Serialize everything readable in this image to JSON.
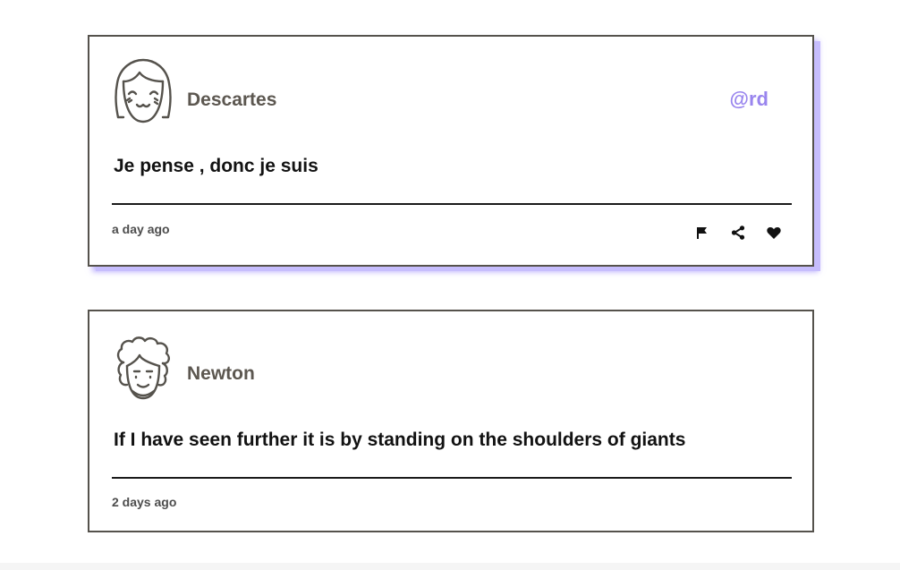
{
  "tweets": [
    {
      "author": "Descartes",
      "handle": "@rd",
      "text": "Je pense , donc je suis",
      "time": "a day ago",
      "avatar_icon": "girl-face-avatar-icon",
      "actions": [
        "flag-icon",
        "share-icon",
        "heart-icon"
      ]
    },
    {
      "author": "Newton",
      "text": "If I have seen further it is by standing on the shoulders of giants",
      "time": "2 days ago",
      "avatar_icon": "curly-hair-face-avatar-icon"
    }
  ],
  "colors": {
    "border": "#55524c",
    "author": "#5c5750",
    "handle": "#9985ee",
    "shadow": "#c6bdfd",
    "text": "#121212"
  }
}
